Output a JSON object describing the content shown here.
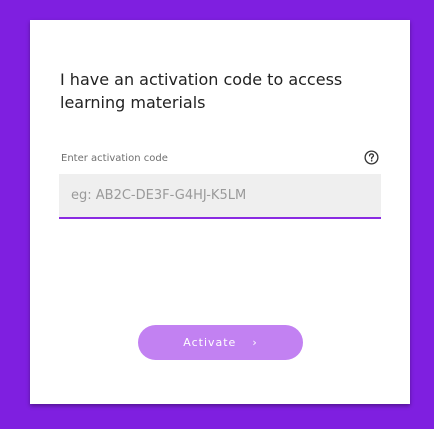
{
  "card": {
    "title": "I have an activation code to access learning materials"
  },
  "field": {
    "label": "Enter activation code",
    "placeholder": "eg: AB2C-DE3F-G4HJ-K5LM",
    "value": ""
  },
  "button": {
    "label": "Activate",
    "chevron": "›"
  },
  "icons": {
    "help": "help-circle-icon",
    "chevron": "chevron-right-icon"
  },
  "colors": {
    "background": "#7f1fe0",
    "accent": "#8a2be2",
    "button": "#c281f2"
  }
}
